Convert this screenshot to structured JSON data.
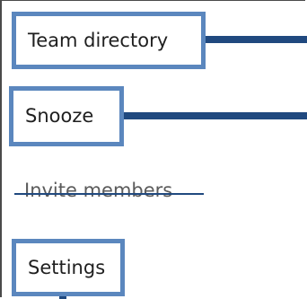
{
  "menu": {
    "items": [
      {
        "label": "Team directory",
        "state": "highlighted"
      },
      {
        "label": "Snooze",
        "state": "highlighted"
      },
      {
        "label": "Invite members",
        "state": "struck-through"
      },
      {
        "label": "Settings",
        "state": "highlighted"
      }
    ]
  },
  "colors": {
    "highlight_border": "#5b87be",
    "connector": "#20497f",
    "text": "#1f1f1f"
  }
}
